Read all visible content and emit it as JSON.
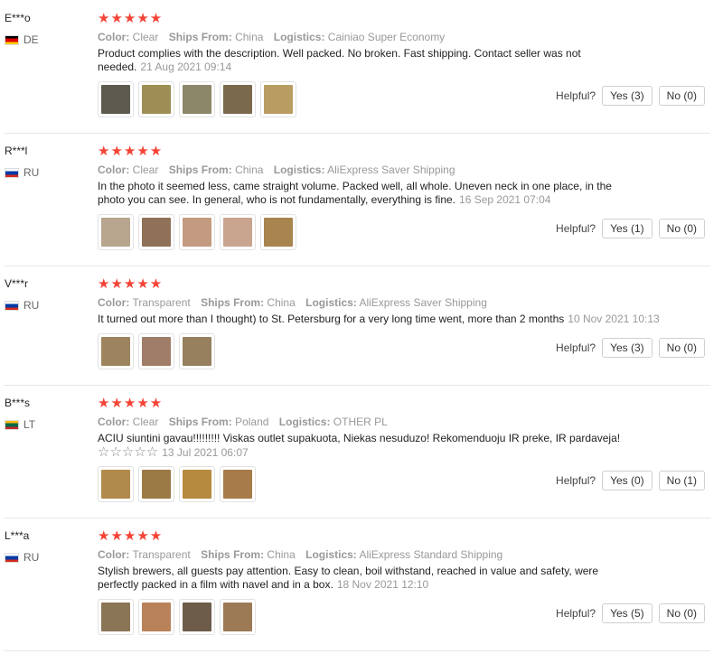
{
  "reviews": [
    {
      "user": "E***o",
      "country": "DE",
      "flag": "flag-de-icon",
      "stars": "★★★★★",
      "color_label": "Color:",
      "color": "Clear",
      "ships_label": "Ships From:",
      "ships": "China",
      "logistics_label": "Logistics:",
      "logistics": "Cainiao Super Economy",
      "text": "Product complies with the description. Well packed. No broken. Fast shipping. Contact seller was not needed.",
      "date": "21 Aug 2021 09:14",
      "thumb_colors": [
        "#5d5a4f",
        "#9c8e55",
        "#8c8768",
        "#7a6a4b",
        "#b89c62"
      ],
      "helpful_label": "Helpful?",
      "yes": "Yes (3)",
      "no": "No (0)"
    },
    {
      "user": "R***l",
      "country": "RU",
      "flag": "flag-ru-icon",
      "stars": "★★★★★",
      "color_label": "Color:",
      "color": "Clear",
      "ships_label": "Ships From:",
      "ships": "China",
      "logistics_label": "Logistics:",
      "logistics": "AliExpress Saver Shipping",
      "text": "In the photo it seemed less, came straight volume. Packed well, all whole. Uneven neck in one place, in the photo you can see. In general, who is not fundamentally, everything is fine.",
      "date": "16 Sep 2021 07:04",
      "thumb_colors": [
        "#b7a58e",
        "#8e7157",
        "#c39b80",
        "#c9a590",
        "#a8844f"
      ],
      "helpful_label": "Helpful?",
      "yes": "Yes (1)",
      "no": "No (0)"
    },
    {
      "user": "V***r",
      "country": "RU",
      "flag": "flag-ru-icon",
      "stars": "★★★★★",
      "color_label": "Color:",
      "color": "Transparent",
      "ships_label": "Ships From:",
      "ships": "China",
      "logistics_label": "Logistics:",
      "logistics": "AliExpress Saver Shipping",
      "text": "It turned out more than I thought) to St. Petersburg for a very long time went, more than 2 months",
      "date": "10 Nov 2021 10:13",
      "thumb_colors": [
        "#9d845e",
        "#a07d69",
        "#96805e"
      ],
      "helpful_label": "Helpful?",
      "yes": "Yes (3)",
      "no": "No (0)"
    },
    {
      "user": "B***s",
      "country": "LT",
      "flag": "flag-lt-icon",
      "stars": "★★★★★",
      "color_label": "Color:",
      "color": "Clear",
      "ships_label": "Ships From:",
      "ships": "Poland",
      "logistics_label": "Logistics:",
      "logistics": "OTHER PL",
      "text": "ACIU siuntini gavau!!!!!!!!! Viskas outlet supakuota, Niekas nesuduzo! Rekomenduoju IR preke, IR pardaveja!",
      "sub_stars": "☆☆☆☆☆",
      "date": "13 Jul 2021 06:07",
      "thumb_colors": [
        "#b08a4a",
        "#9b7a45",
        "#b68b3f",
        "#a77b4a"
      ],
      "helpful_label": "Helpful?",
      "yes": "Yes (0)",
      "no": "No (1)"
    },
    {
      "user": "L***a",
      "country": "RU",
      "flag": "flag-ru-icon",
      "stars": "★★★★★",
      "color_label": "Color:",
      "color": "Transparent",
      "ships_label": "Ships From:",
      "ships": "China",
      "logistics_label": "Logistics:",
      "logistics": "AliExpress Standard Shipping",
      "text": "Stylish brewers, all guests pay attention. Easy to clean, boil withstand, reached in value and safety, were perfectly packed in a film with navel and in a box.",
      "date": "18 Nov 2021 12:10",
      "thumb_colors": [
        "#8a7556",
        "#b9825a",
        "#6d5c4a",
        "#9c7a55"
      ],
      "helpful_label": "Helpful?",
      "yes": "Yes (5)",
      "no": "No (0)"
    }
  ]
}
